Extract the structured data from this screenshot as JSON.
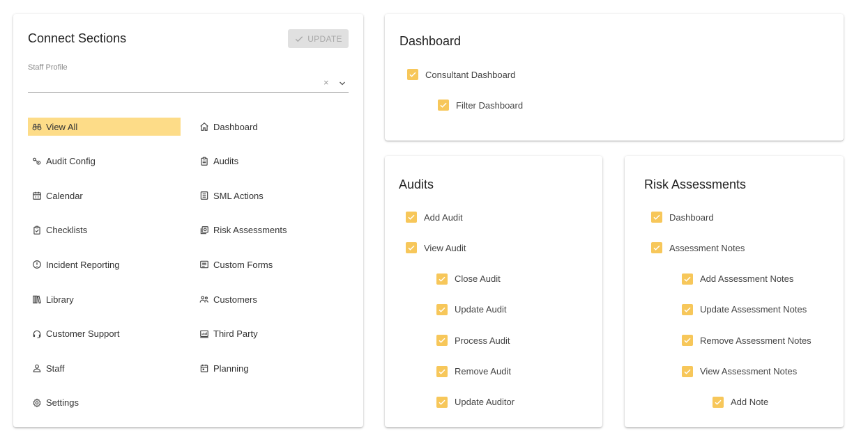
{
  "connect": {
    "title": "Connect Sections",
    "update_label": "UPDATE",
    "staff_profile": {
      "label": "Staff Profile",
      "value": "",
      "clear_glyph": "×"
    },
    "nav_left": [
      {
        "label": "View All",
        "icon": "binoculars-icon",
        "active": true
      },
      {
        "label": "Audit Config",
        "icon": "audit-config-icon"
      },
      {
        "label": "Calendar",
        "icon": "calendar-icon"
      },
      {
        "label": "Checklists",
        "icon": "clipboard-check-icon"
      },
      {
        "label": "Incident Reporting",
        "icon": "alert-circle-icon"
      },
      {
        "label": "Library",
        "icon": "library-icon"
      },
      {
        "label": "Customer Support",
        "icon": "headset-icon"
      },
      {
        "label": "Staff",
        "icon": "person-icon"
      },
      {
        "label": "Settings",
        "icon": "gear-icon"
      }
    ],
    "nav_right": [
      {
        "label": "Dashboard",
        "icon": "home-icon"
      },
      {
        "label": "Audits",
        "icon": "clipboard-icon"
      },
      {
        "label": "SML Actions",
        "icon": "list-document-icon"
      },
      {
        "label": "Risk Assessments",
        "icon": "risk-assessment-icon"
      },
      {
        "label": "Custom Forms",
        "icon": "form-icon"
      },
      {
        "label": "Customers",
        "icon": "people-icon"
      },
      {
        "label": "Third Party",
        "icon": "third-party-icon"
      },
      {
        "label": "Planning",
        "icon": "planning-icon"
      }
    ]
  },
  "dashboard": {
    "title": "Dashboard",
    "items": [
      {
        "label": "Consultant Dashboard",
        "checked": true,
        "level": 0
      },
      {
        "label": "Filter Dashboard",
        "checked": true,
        "level": 1
      }
    ]
  },
  "audits": {
    "title": "Audits",
    "items": [
      {
        "label": "Add Audit",
        "checked": true,
        "level": 0
      },
      {
        "label": "View Audit",
        "checked": true,
        "level": 0
      },
      {
        "label": "Close Audit",
        "checked": true,
        "level": 1
      },
      {
        "label": "Update Audit",
        "checked": true,
        "level": 1
      },
      {
        "label": "Process Audit",
        "checked": true,
        "level": 1
      },
      {
        "label": "Remove Audit",
        "checked": true,
        "level": 1
      },
      {
        "label": "Update Auditor",
        "checked": true,
        "level": 1
      }
    ]
  },
  "risk": {
    "title": "Risk Assessments",
    "items": [
      {
        "label": "Dashboard",
        "checked": true,
        "level": 0
      },
      {
        "label": "Assessment Notes",
        "checked": true,
        "level": 0
      },
      {
        "label": "Add Assessment Notes",
        "checked": true,
        "level": 1
      },
      {
        "label": "Update Assessment Notes",
        "checked": true,
        "level": 1
      },
      {
        "label": "Remove Assessment Notes",
        "checked": true,
        "level": 1
      },
      {
        "label": "View Assessment Notes",
        "checked": true,
        "level": 1
      },
      {
        "label": "Add Note",
        "checked": true,
        "level": 2
      }
    ]
  },
  "colors": {
    "accent": "#f7c75a",
    "active_nav": "#fddc88",
    "disabled_button": "#e0e0e0"
  }
}
